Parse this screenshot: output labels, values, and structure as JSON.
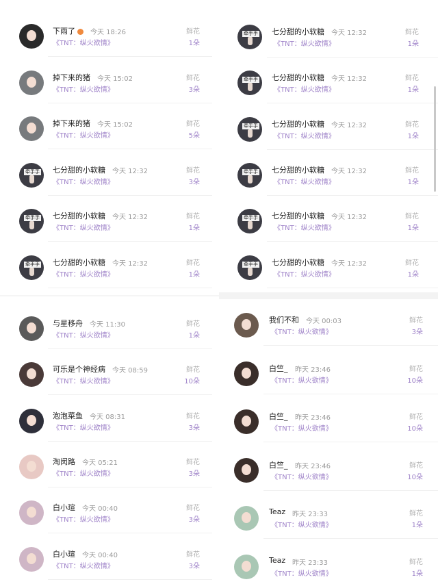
{
  "gift_label": "鲜花",
  "panels": [
    {
      "id": "left-top",
      "rows": [
        {
          "name": "下雨了",
          "emoji": true,
          "time": "今天 18:26",
          "sub": "《TNT：纵火欲情》",
          "count": "1朵",
          "avatar": "woman",
          "color": "#2a2a2a"
        },
        {
          "name": "掉下来的猪",
          "time": "今天 15:02",
          "sub": "《TNT：纵火欲情》",
          "count": "3朵",
          "avatar": "scene",
          "color": "#777a7d"
        },
        {
          "name": "掉下来的猪",
          "time": "今天 15:02",
          "sub": "《TNT：纵火欲情》",
          "count": "5朵",
          "avatar": "scene",
          "color": "#777a7d"
        },
        {
          "name": "七分甜的小软糖",
          "time": "今天 12:32",
          "sub": "《TNT：纵火欲情》",
          "count": "3朵",
          "avatar": "hand",
          "color": "#3c3c44"
        },
        {
          "name": "七分甜的小软糖",
          "time": "今天 12:32",
          "sub": "《TNT：纵火欲情》",
          "count": "1朵",
          "avatar": "hand",
          "color": "#3c3c44"
        },
        {
          "name": "七分甜的小软糖",
          "time": "今天 12:32",
          "sub": "《TNT：纵火欲情》",
          "count": "1朵",
          "avatar": "hand",
          "color": "#3c3c44"
        }
      ]
    },
    {
      "id": "left-bottom",
      "rows": [
        {
          "name": "与星移舟",
          "time": "今天 11:30",
          "sub": "《TNT：纵火欲情》",
          "count": "1朵",
          "avatar": "man",
          "color": "#5a5a5a"
        },
        {
          "name": "可乐是个神经病",
          "time": "今天 08:59",
          "sub": "《TNT：纵火欲情》",
          "count": "10朵",
          "avatar": "woman",
          "color": "#4a3a38"
        },
        {
          "name": "泡泡菜鱼",
          "time": "今天 08:31",
          "sub": "《TNT：纵火欲情》",
          "count": "3朵",
          "avatar": "anime",
          "color": "#2e2f3a"
        },
        {
          "name": "淘闵路",
          "time": "今天 05:21",
          "sub": "《TNT：纵火欲情》",
          "count": "3朵",
          "avatar": "anime",
          "color": "#e8c9c4"
        },
        {
          "name": "白小瑄",
          "time": "今天 00:40",
          "sub": "《TNT：纵火欲情》",
          "count": "3朵",
          "avatar": "anime",
          "color": "#cfb6c6"
        },
        {
          "name": "白小瑄",
          "time": "今天 00:40",
          "sub": "《TNT：纵火欲情》",
          "count": "3朵",
          "avatar": "anime",
          "color": "#cfb6c6"
        }
      ]
    },
    {
      "id": "right-top",
      "rows": [
        {
          "name": "七分甜的小软糖",
          "time": "今天 12:32",
          "sub": "《TNT：纵火欲情》",
          "count": "1朵",
          "avatar": "hand",
          "color": "#3c3c44"
        },
        {
          "name": "七分甜的小软糖",
          "time": "今天 12:32",
          "sub": "《TNT：纵火欲情》",
          "count": "1朵",
          "avatar": "hand",
          "color": "#3c3c44"
        },
        {
          "name": "七分甜的小软糖",
          "time": "今天 12:32",
          "sub": "《TNT：纵火欲情》",
          "count": "1朵",
          "avatar": "hand",
          "color": "#3c3c44"
        },
        {
          "name": "七分甜的小软糖",
          "time": "今天 12:32",
          "sub": "《TNT：纵火欲情》",
          "count": "1朵",
          "avatar": "hand",
          "color": "#3c3c44"
        },
        {
          "name": "七分甜的小软糖",
          "time": "今天 12:32",
          "sub": "《TNT：纵火欲情》",
          "count": "1朵",
          "avatar": "hand",
          "color": "#3c3c44"
        },
        {
          "name": "七分甜的小软糖",
          "time": "今天 12:32",
          "sub": "《TNT：纵火欲情》",
          "count": "1朵",
          "avatar": "hand",
          "color": "#3c3c44"
        }
      ]
    },
    {
      "id": "right-bottom",
      "rows": [
        {
          "name": "我们不和",
          "time": "今天 00:03",
          "sub": "《TNT：纵火欲情》",
          "count": "3朵",
          "avatar": "man",
          "color": "#6b5a4e"
        },
        {
          "name": "白竺_",
          "time": "昨天 23:46",
          "sub": "《TNT：纵火欲情》",
          "count": "10朵",
          "avatar": "anime",
          "color": "#3a2e2a"
        },
        {
          "name": "白竺_",
          "time": "昨天 23:46",
          "sub": "《TNT：纵火欲情》",
          "count": "10朵",
          "avatar": "anime",
          "color": "#3a2e2a"
        },
        {
          "name": "白竺_",
          "time": "昨天 23:46",
          "sub": "《TNT：纵火欲情》",
          "count": "10朵",
          "avatar": "anime",
          "color": "#3a2e2a"
        },
        {
          "name": "Teaz",
          "time": "昨天 23:33",
          "sub": "《TNT：纵火欲情》",
          "count": "1朵",
          "avatar": "anime",
          "color": "#a9c7b4"
        },
        {
          "name": "Teaz",
          "time": "昨天 23:33",
          "sub": "《TNT：纵火欲情》",
          "count": "1朵",
          "avatar": "anime",
          "color": "#a9c7b4"
        }
      ]
    }
  ]
}
